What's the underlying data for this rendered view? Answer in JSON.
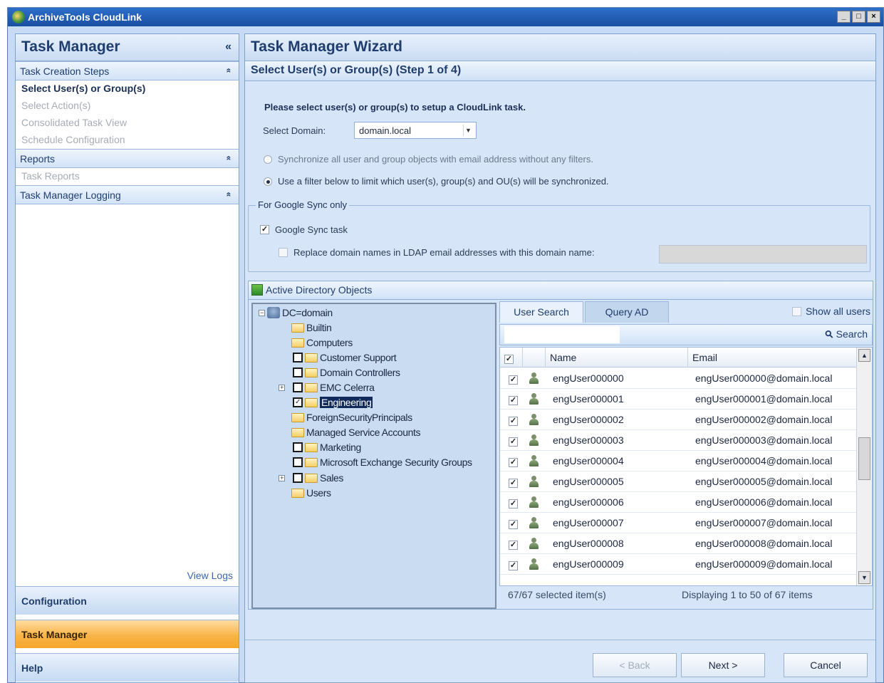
{
  "window": {
    "title": "ArchiveTools CloudLink",
    "min": "_",
    "max": "□",
    "close": "×"
  },
  "left": {
    "title": "Task Manager",
    "collapse": "«",
    "sections": [
      {
        "label": "Task Creation Steps",
        "chev": "«"
      },
      {
        "label": "Reports",
        "chev": "«"
      },
      {
        "label": "Task Manager Logging",
        "chev": "«"
      }
    ],
    "steps": [
      "Select User(s) or Group(s)",
      "Select Action(s)",
      "Consolidated Task View",
      "Schedule Configuration"
    ],
    "reports": [
      "Task Reports"
    ],
    "view_logs": "View Logs",
    "buttons": [
      "Configuration",
      "Task Manager",
      "Help"
    ]
  },
  "wizard": {
    "title": "Task Manager Wizard",
    "step": "Select User(s) or Group(s) (Step 1 of 4)",
    "instruction": "Please select user(s) or group(s) to setup a CloudLink task.",
    "domain_label": "Select Domain:",
    "domain_value": "domain.local",
    "radio_all": "Synchronize all user and group objects with email address without any filters.",
    "radio_filter": "Use a filter below to limit which user(s), group(s) and OU(s) will be synchronized.",
    "google_group": "For Google Sync only",
    "google_task": "Google Sync task",
    "replace_domain": "Replace domain names in LDAP email addresses with this domain name:",
    "ad_title": "Active Directory Objects"
  },
  "tree": {
    "root": "DC=domain",
    "nodes": [
      "Builtin",
      "Computers",
      "Customer Support",
      "Domain Controllers",
      "EMC Celerra",
      "Engineering",
      "ForeignSecurityPrincipals",
      "Managed Service Accounts",
      "Marketing",
      "Microsoft Exchange Security Groups",
      "Sales",
      "Users"
    ]
  },
  "users": {
    "tab_search": "User Search",
    "tab_query": "Query AD",
    "show_all": "Show all users",
    "search": "Search",
    "col_name": "Name",
    "col_email": "Email",
    "rows": [
      {
        "name": "engUser000000",
        "email": "engUser000000@domain.local"
      },
      {
        "name": "engUser000001",
        "email": "engUser000001@domain.local"
      },
      {
        "name": "engUser000002",
        "email": "engUser000002@domain.local"
      },
      {
        "name": "engUser000003",
        "email": "engUser000003@domain.local"
      },
      {
        "name": "engUser000004",
        "email": "engUser000004@domain.local"
      },
      {
        "name": "engUser000005",
        "email": "engUser000005@domain.local"
      },
      {
        "name": "engUser000006",
        "email": "engUser000006@domain.local"
      },
      {
        "name": "engUser000007",
        "email": "engUser000007@domain.local"
      },
      {
        "name": "engUser000008",
        "email": "engUser000008@domain.local"
      },
      {
        "name": "engUser000009",
        "email": "engUser000009@domain.local"
      }
    ],
    "selected_count": "67/67 selected item(s)",
    "paging": "Displaying 1 to 50 of 67 items"
  },
  "buttons": {
    "back": "< Back",
    "next": "Next >",
    "cancel": "Cancel"
  },
  "icons": {
    "check": "✓",
    "minus": "−",
    "plus": "+",
    "arrow_down": "▼",
    "arrow_up": "▲",
    "search": "⚲"
  }
}
